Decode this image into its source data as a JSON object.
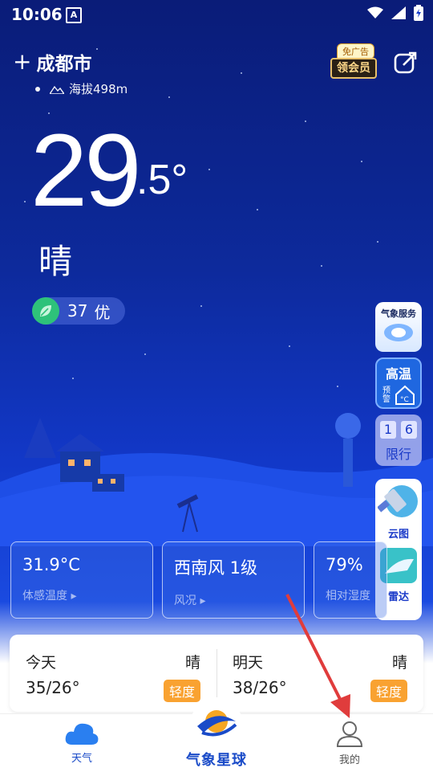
{
  "status_bar": {
    "time": "10:06",
    "notif_letter": "A"
  },
  "header": {
    "city": "成都市",
    "elevation": "海拔498m",
    "vip_tag": "免广告",
    "vip_label": "领会员"
  },
  "weather": {
    "temp_int": "29",
    "temp_dec": ".5°",
    "condition": "晴",
    "aqi_value": "37",
    "aqi_level": "优"
  },
  "side_widgets": {
    "service": "气象服务",
    "heat_top": "高温",
    "heat_left": "预警",
    "limit_nums": [
      "1",
      "6"
    ],
    "limit_label": "限行",
    "cloud_label": "云图",
    "radar_label": "雷达"
  },
  "cards": [
    {
      "value": "31.9°C",
      "label": "体感温度"
    },
    {
      "value": "西南风 1级",
      "label": "风况"
    },
    {
      "value": "79%",
      "label": "相对湿度"
    }
  ],
  "forecast": [
    {
      "day": "今天",
      "weather": "晴",
      "range": "35/26°",
      "aqi": "轻度"
    },
    {
      "day": "明天",
      "weather": "晴",
      "range": "38/26°",
      "aqi": "轻度"
    }
  ],
  "nav": {
    "weather": "天气",
    "home": "气象星球",
    "me": "我的"
  },
  "colors": {
    "aqi_good": "#2ec27a",
    "aqi_light": "#f9a231",
    "brand": "#1a4bc8",
    "arrow": "#e03c3c"
  }
}
